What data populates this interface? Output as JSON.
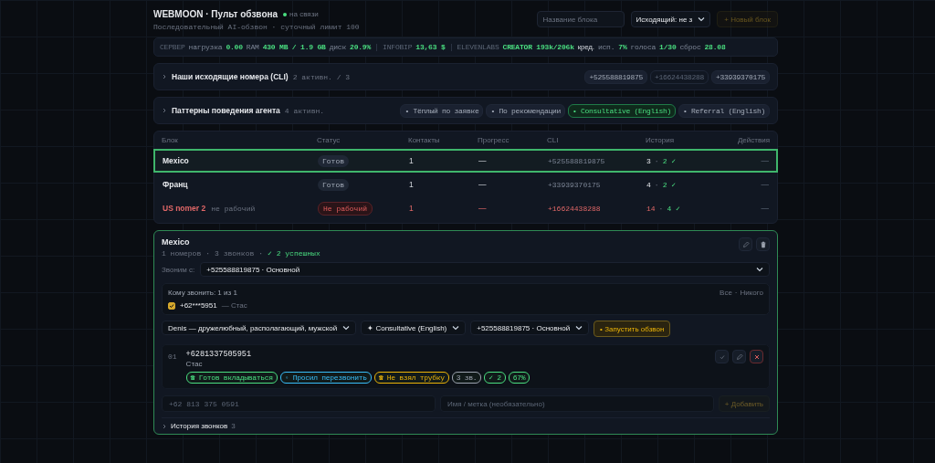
{
  "header": {
    "title": "WEBMOON · Пульт обзвона",
    "status": {
      "label": "на связи",
      "online": true
    },
    "subtitle": "Последовательный AI-обзвон · суточный лимит 100",
    "name_field": {
      "placeholder": "Название блока"
    },
    "outgoing_select": {
      "value": "Исходящий: не з"
    },
    "new_block_button": {
      "label": "+ Новый блок",
      "disabled": true
    }
  },
  "stats": [
    {
      "kind": "section",
      "label": "СЕРВЕР"
    },
    {
      "kind": "metric",
      "label": "нагрузка",
      "value": "0.00"
    },
    {
      "kind": "metric",
      "label": "RAM",
      "value": "430 MB / 1.9 GB"
    },
    {
      "kind": "metric",
      "label": "диск",
      "value": "20.9%"
    },
    {
      "kind": "section",
      "label": "INFOBIP"
    },
    {
      "kind": "metric",
      "value": "13,63 $"
    },
    {
      "kind": "section",
      "label": "ELEVENLABS"
    },
    {
      "kind": "metric",
      "value": "CREATOR 193k/206k",
      "unit": "кред."
    },
    {
      "kind": "metric",
      "label": "исп.",
      "value": "7%"
    },
    {
      "kind": "metric",
      "label": "голоса",
      "value": "1/30"
    },
    {
      "kind": "metric",
      "label": "сброс",
      "value": "28.08"
    }
  ],
  "cli_panel": {
    "title": "Наши исходящие номера (CLI)",
    "count": "2 активн. / 3",
    "expanded": false,
    "chips": [
      {
        "label": "+525588819875",
        "active": true
      },
      {
        "label": "+16624438288",
        "active": false
      },
      {
        "label": "+33939370175",
        "active": true
      }
    ]
  },
  "patterns_panel": {
    "title": "Паттерны поведения агента",
    "count": "4 активн.",
    "expanded": false,
    "chips": [
      {
        "label": "• Тёплый по заявке",
        "selected": false
      },
      {
        "label": "• По рекомендации",
        "selected": false
      },
      {
        "label": "• Consultative (English)",
        "selected": true
      },
      {
        "label": "• Referral (English)",
        "selected": false
      }
    ]
  },
  "table": {
    "columns": [
      "Блок",
      "Статус",
      "Контакты",
      "Прогресс",
      "CLI",
      "История",
      "Действия"
    ],
    "rows": [
      {
        "name": "Mexico",
        "selected": true,
        "broken": false,
        "status": "Готов",
        "contacts": "1",
        "progress": "—",
        "cli": "+525588819875",
        "calls": "3",
        "separator": "·",
        "success": "2 ✓",
        "actions": "—"
      },
      {
        "name": "Франц",
        "selected": false,
        "broken": false,
        "status": "Готов",
        "contacts": "1",
        "progress": "—",
        "cli": "+33939370175",
        "calls": "4",
        "separator": "·",
        "success": "2 ✓",
        "actions": "—"
      },
      {
        "name": "US nomer 2",
        "note": "не рабочий",
        "selected": false,
        "broken": true,
        "status": "Не рабочий",
        "contacts": "1",
        "progress": "—",
        "cli": "+16624438288",
        "calls": "14",
        "separator": "·",
        "success": "4 ✓",
        "actions": "—"
      }
    ]
  },
  "detail": {
    "title": "Mexico",
    "meta": [
      "1 номеров",
      "·",
      "3 звонков",
      "·"
    ],
    "success": "✓ 2 успешных",
    "caller_label": "Звоним с:",
    "caller_value": "+525588819875 · Основной",
    "recipients": {
      "title": "Кому звонить: 1 из 1",
      "all_link": "Все",
      "separator": "·",
      "none_link": "Никого",
      "contacts": [
        {
          "number": "+62***5951",
          "name": "— Стас",
          "checked": true
        }
      ]
    },
    "voice_select": "Denis — дружелюбный, располагающий, мужской",
    "pattern_select": "✦ Consultative (English)",
    "cli_select": "+525588819875 · Основной",
    "start_button": "• Запустить обзвон",
    "contacts": [
      {
        "index": "01",
        "number": "+6281337505951",
        "name": "Стас",
        "tags": [
          {
            "label": "☎ Готов вкладываться",
            "color": "#4ade80"
          },
          {
            "label": "◦ Просил перезвонить",
            "color": "#38bdf8"
          },
          {
            "label": "☎ Не взял трубку",
            "color": "#eab308"
          },
          {
            "label": "3 зв.",
            "color": "#9ca3af"
          },
          {
            "label": "✓ 2",
            "color": "#4ade80"
          },
          {
            "label": "67%",
            "color": "#4ade80"
          }
        ]
      }
    ],
    "phone_field": {
      "placeholder": "+62 813 375 0591"
    },
    "label_field": {
      "placeholder": "Имя / метка (необязательно)"
    },
    "add_button": {
      "label": "+ Добавить",
      "disabled": true
    },
    "history": {
      "title": "История звонков",
      "count": "3",
      "expanded": false
    }
  }
}
